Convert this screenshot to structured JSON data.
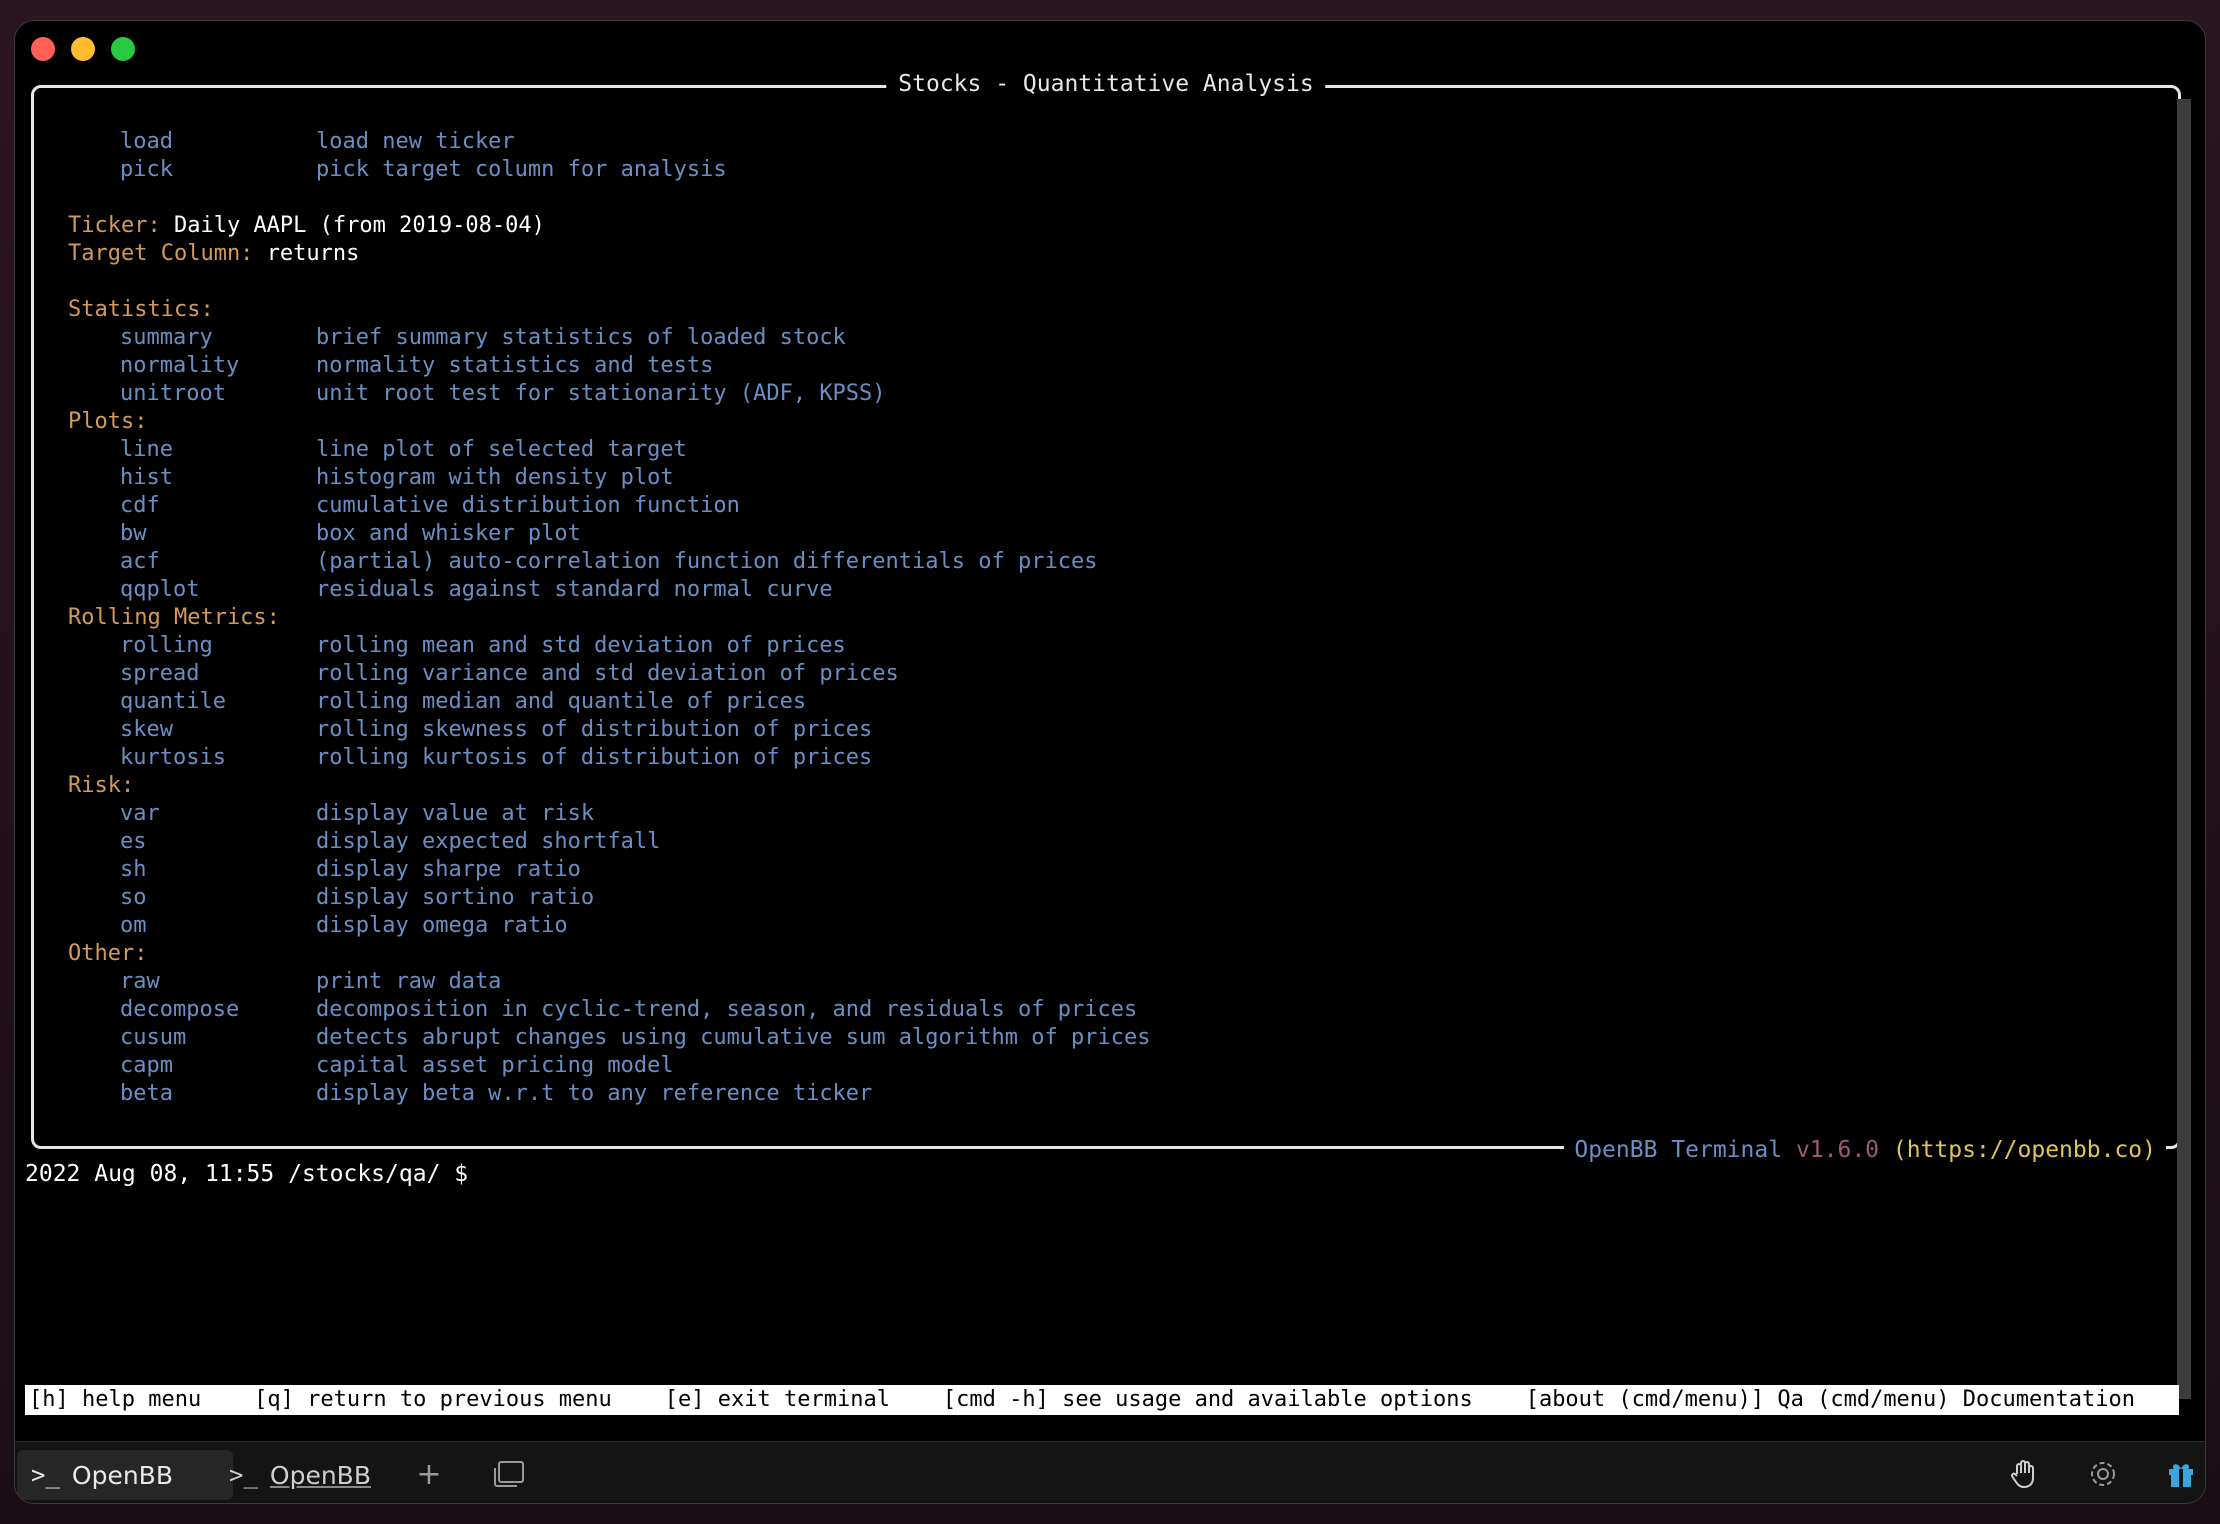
{
  "window": {
    "panel_title": "Stocks - Quantitative Analysis",
    "footer": {
      "brand": "OpenBB Terminal",
      "version": "v1.6.0",
      "url": "(https://openbb.co)"
    }
  },
  "top_commands": [
    {
      "cmd": "load",
      "desc": "load new ticker"
    },
    {
      "cmd": "pick",
      "desc": "pick target column for analysis"
    }
  ],
  "ticker": {
    "label": "Ticker:",
    "value": "Daily AAPL (from 2019-08-04)"
  },
  "target_column": {
    "label": "Target Column:",
    "value": "returns"
  },
  "sections": [
    {
      "title": "Statistics:",
      "items": [
        {
          "cmd": "summary",
          "desc": "brief summary statistics of loaded stock"
        },
        {
          "cmd": "normality",
          "desc": "normality statistics and tests"
        },
        {
          "cmd": "unitroot",
          "desc": "unit root test for stationarity (ADF, KPSS)"
        }
      ]
    },
    {
      "title": "Plots:",
      "items": [
        {
          "cmd": "line",
          "desc": "line plot of selected target"
        },
        {
          "cmd": "hist",
          "desc": "histogram with density plot"
        },
        {
          "cmd": "cdf",
          "desc": "cumulative distribution function"
        },
        {
          "cmd": "bw",
          "desc": "box and whisker plot"
        },
        {
          "cmd": "acf",
          "desc": "(partial) auto-correlation function differentials of prices"
        },
        {
          "cmd": "qqplot",
          "desc": "residuals against standard normal curve"
        }
      ]
    },
    {
      "title": "Rolling Metrics:",
      "items": [
        {
          "cmd": "rolling",
          "desc": "rolling mean and std deviation of prices"
        },
        {
          "cmd": "spread",
          "desc": "rolling variance and std deviation of prices"
        },
        {
          "cmd": "quantile",
          "desc": "rolling median and quantile of prices"
        },
        {
          "cmd": "skew",
          "desc": "rolling skewness of distribution of prices"
        },
        {
          "cmd": "kurtosis",
          "desc": "rolling kurtosis of distribution of prices"
        }
      ]
    },
    {
      "title": "Risk:",
      "items": [
        {
          "cmd": "var",
          "desc": "display value at risk"
        },
        {
          "cmd": "es",
          "desc": "display expected shortfall"
        },
        {
          "cmd": "sh",
          "desc": "display sharpe ratio"
        },
        {
          "cmd": "so",
          "desc": "display sortino ratio"
        },
        {
          "cmd": "om",
          "desc": "display omega ratio"
        }
      ]
    },
    {
      "title": "Other:",
      "items": [
        {
          "cmd": "raw",
          "desc": "print raw data"
        },
        {
          "cmd": "decompose",
          "desc": "decomposition in cyclic-trend, season, and residuals of prices"
        },
        {
          "cmd": "cusum",
          "desc": "detects abrupt changes using cumulative sum algorithm of prices"
        },
        {
          "cmd": "capm",
          "desc": "capital asset pricing model"
        },
        {
          "cmd": "beta",
          "desc": "display beta w.r.t to any reference ticker"
        }
      ]
    }
  ],
  "prompt": "2022 Aug 08, 11:55 /stocks/qa/ $",
  "helpbar": "[h] help menu    [q] return to previous menu    [e] exit terminal    [cmd -h] see usage and available options    [about (cmd/menu)] Qa (cmd/menu) Documentation",
  "tabs": [
    {
      "label": "OpenBB",
      "active": true
    },
    {
      "label": "OpenBB",
      "active": false
    }
  ],
  "tabbar_icons": [
    "plus-icon",
    "window-icon",
    "hand-icon",
    "gear-icon",
    "gift-icon"
  ],
  "colors": {
    "command": "#6b8fc4",
    "section": "#d49a5a",
    "version": "#a0587a",
    "url": "#e0c55a"
  }
}
